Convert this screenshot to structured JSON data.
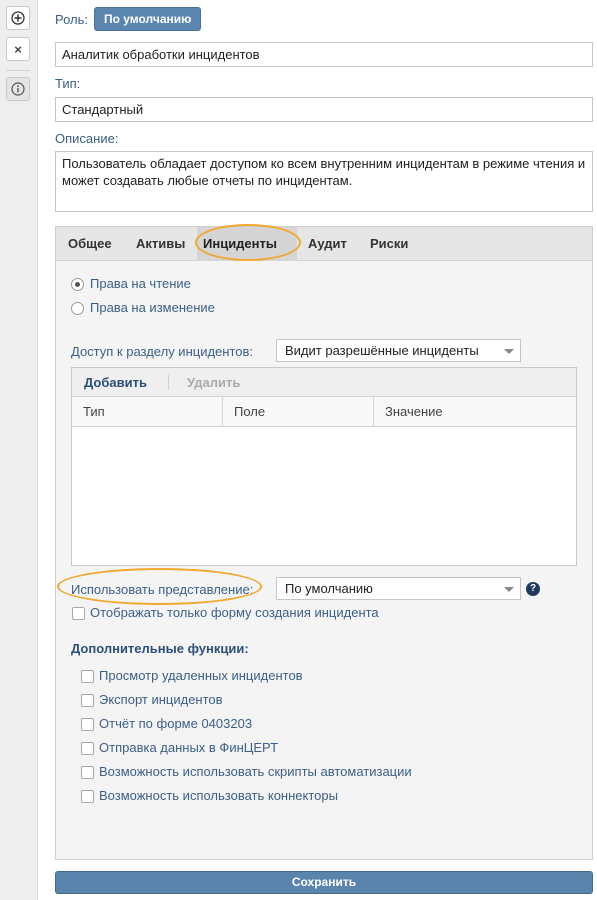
{
  "toolbar": {
    "add_icon": "⊕",
    "close_icon": "×",
    "info_icon": "i"
  },
  "role": {
    "label": "Роль:",
    "default_button": "По умолчанию"
  },
  "name_field": {
    "value": "Аналитик обработки инцидентов"
  },
  "type": {
    "label": "Тип:",
    "value": "Стандартный"
  },
  "description": {
    "label": "Описание:",
    "value": "Пользователь обладает доступом ко всем внутренним инцидентам в режиме чтения и может создавать любые отчеты по инцидентам."
  },
  "tabs": [
    {
      "label": "Общее"
    },
    {
      "label": "Активы"
    },
    {
      "label": "Инциденты",
      "active": true
    },
    {
      "label": "Аудит"
    },
    {
      "label": "Риски"
    }
  ],
  "rights": {
    "read": "Права на чтение",
    "edit": "Права на изменение",
    "selected": "read"
  },
  "access": {
    "label": "Доступ к разделу инцидентов:",
    "value": "Видит разрешённые инциденты"
  },
  "grid": {
    "add_label": "Добавить",
    "delete_label": "Удалить",
    "columns": [
      "Тип",
      "Поле",
      "Значение"
    ],
    "rows": []
  },
  "view": {
    "label": "Использовать представление:",
    "value": "По умолчанию",
    "help_icon": "?",
    "only_form_label": "Отображать только форму создания инцидента"
  },
  "extra": {
    "title": "Дополнительные функции:",
    "items": [
      "Просмотр удаленных инцидентов",
      "Экспорт инцидентов",
      "Отчёт по форме 0403203",
      "Отправка данных в ФинЦЕРТ",
      "Возможность использовать скрипты автоматизации",
      "Возможность использовать коннекторы"
    ]
  },
  "save_label": "Сохранить",
  "colors": {
    "accent": "#5a84ac",
    "label": "#3b5f86",
    "highlight": "#f0a830"
  }
}
